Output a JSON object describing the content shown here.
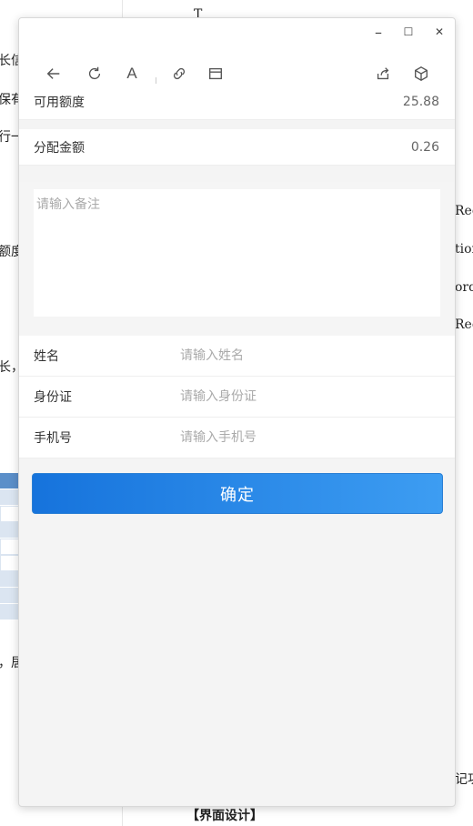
{
  "background_doc": {
    "fragments_left": [
      "长信",
      "保有",
      "行一",
      "额度",
      "长，",
      "，居"
    ],
    "fragments_right": [
      "Recor",
      "tionI",
      "ord",
      "Rec",
      "记功"
    ],
    "top_fragment": "T",
    "footer_heading": "【界面设计】"
  },
  "window_controls": {
    "minimize": "–",
    "maximize": "☐",
    "close": "✕"
  },
  "toolbar": {
    "icons": [
      "back-arrow-icon",
      "refresh-icon",
      "font-icon",
      "link-icon",
      "window-icon",
      "share-icon",
      "cube-icon"
    ],
    "font_glyph": "A"
  },
  "available_amount": {
    "label": "可用额度",
    "value": "25.88"
  },
  "allocated_amount": {
    "label": "分配金额",
    "value": "0.26"
  },
  "remark": {
    "placeholder": "请输入备注"
  },
  "form": {
    "name": {
      "label": "姓名",
      "placeholder": "请输入姓名"
    },
    "id_card": {
      "label": "身份证",
      "placeholder": "请输入身份证"
    },
    "phone": {
      "label": "手机号",
      "placeholder": "请输入手机号"
    }
  },
  "confirm_button": {
    "label": "确定"
  },
  "colors": {
    "accent_start": "#1673dc",
    "accent_end": "#3d9df2",
    "page_bg": "#f4f4f4"
  }
}
